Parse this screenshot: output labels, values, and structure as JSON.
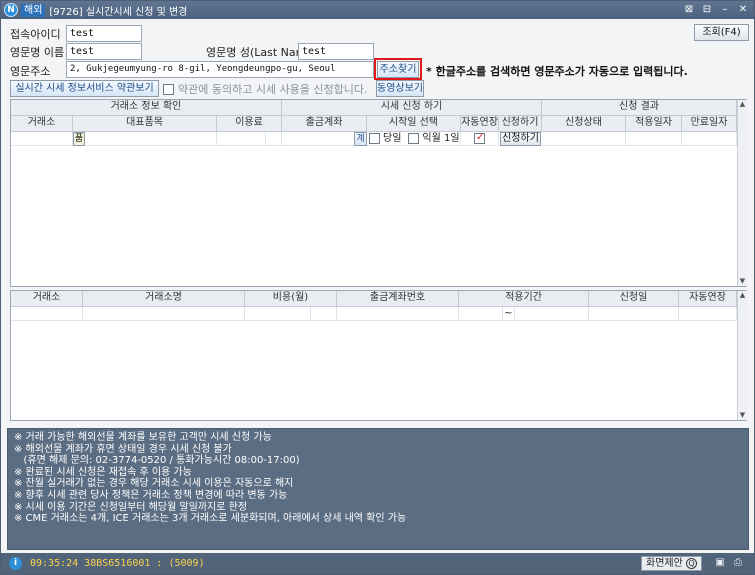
{
  "window": {
    "tag": "해외",
    "title": "[9726] 실시간시세 신청 및 변경",
    "logo": "N"
  },
  "form": {
    "login_id_label": "접속아이디",
    "login_id_value": "test",
    "eng_first_label": "영문명 이름",
    "eng_first_value": "test",
    "eng_last_label": "영문명 성(Last Name)",
    "eng_last_value": "test",
    "eng_addr_label": "영문주소",
    "eng_addr_value": "2, Gukjegeumyung-ro 8-gil, Yeongdeungpo-gu, Seoul",
    "addr_search_button": "주소찾기",
    "addr_note": "* 한글주소를 검색하면 영문주소가 자동으로 입력됩니다.",
    "query_button": "조회(F4)",
    "terms_button": "실시간 시세 정보서비스 약관보기",
    "agree_label": "약관에 동의하고 시세 사용을 신청합니다.",
    "video_button": "동영상보기"
  },
  "grid1": {
    "groups": [
      "거래소 정보 확인",
      "시세 신청 하기",
      "신청 결과"
    ],
    "columns": [
      "거래소",
      "대표품목",
      "이용료",
      "출금계좌",
      "시작일 선택",
      "자동연장",
      "신청하기",
      "신청상태",
      "적용일자",
      "만료일자"
    ],
    "row": {
      "item_button": "품",
      "account_button": "계",
      "today_label": "당일",
      "nextmonth_label": "익월 1일",
      "auto_extend_checked": true,
      "apply_button": "신청하기"
    }
  },
  "grid2": {
    "columns": [
      "거래소",
      "거래소명",
      "비용(월)",
      "출금계좌번호",
      "적용기간",
      "신청일",
      "자동연장"
    ],
    "row": {
      "period_sep": "~"
    }
  },
  "notes": [
    "※ 거래 가능한 해외선물 계좌를 보유한 고객만 시세 신청 가능",
    "※ 해외선물 계좌가 휴면 상태일 경우 시세 신청 불가",
    "   (휴면 해제 문의: 02-3774-0520 / 통화가능시간 08:00-17:00)",
    "※ 완료된 시세 신청은 재접속 후 이용 가능",
    "※ 잔월 실거래가 없는 경우 해당 거래소 시세 이용은 자동으로 해지",
    "※ 향후 시세 관련 당사 정책은 거래소 정책 변경에 따라 변동 가능",
    "※ 시세 이용 기간은 신청일부터 해당월 말일까지로 한정",
    "※ CME 거래소는 4개, ICE 거래소는 3개 거래소로 세분화되며, 아래에서 상세 내역 확인 가능"
  ],
  "status": {
    "icon": "i",
    "text": "09:35:24 38BS6516001 : (5009)",
    "proposal_button": "화면제안",
    "proposal_badge": "Q"
  },
  "icons": {
    "title_buttons": [
      "pin-icon",
      "layout-icon",
      "minimize-icon",
      "close-icon"
    ],
    "status_icons": [
      "save-icon",
      "print-icon"
    ]
  },
  "colors": {
    "titlebar": "#4f657f",
    "highlight": "#e01818",
    "notes_bg": "#5b6d83",
    "status_text": "#ffd24a"
  }
}
